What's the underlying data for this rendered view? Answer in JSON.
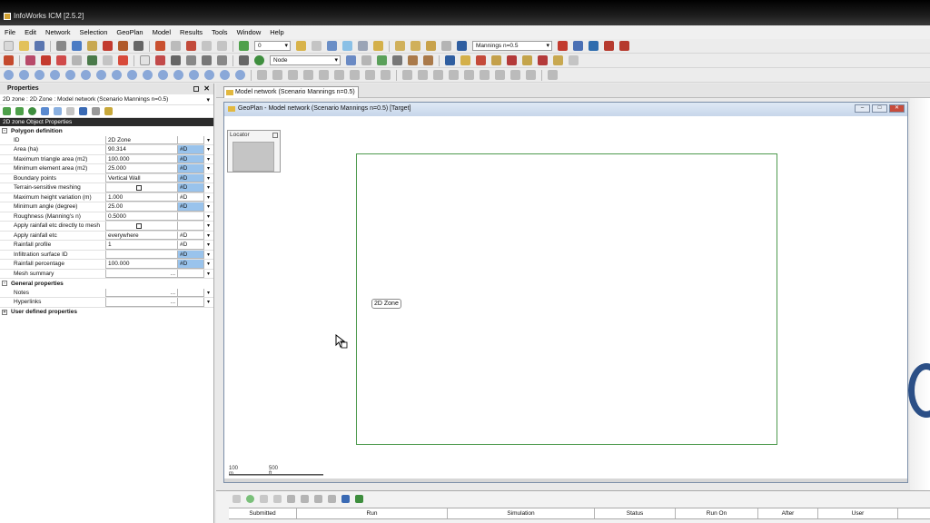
{
  "window": {
    "title": "InfoWorks ICM [2.5.2]"
  },
  "menu": [
    "File",
    "Edit",
    "Network",
    "Selection",
    "GeoPlan",
    "Model",
    "Results",
    "Tools",
    "Window",
    "Help"
  ],
  "toolbar1": {
    "counter_value": "0",
    "scenario_combo": "Mannings n=0.5"
  },
  "toolbar2": {
    "object_type_combo": "Node"
  },
  "properties": {
    "title": "Properties",
    "subtitle": "2D zone : 2D Zone : Model network (Scenario Mannings n=0.5)",
    "object_header": "2D zone Object Properties",
    "sections": [
      {
        "label": "Polygon definition",
        "toggle": "-"
      },
      {
        "label": "General properties",
        "toggle": "-"
      },
      {
        "label": "User defined properties",
        "toggle": "+"
      }
    ],
    "polygon_rows": [
      {
        "name": "ID",
        "value": "2D Zone",
        "flag": "",
        "flag_blue": false,
        "checkbox": false,
        "ellipsis": false
      },
      {
        "name": "Area (ha)",
        "value": "90.314",
        "flag": "#D",
        "flag_blue": true,
        "checkbox": false,
        "ellipsis": false
      },
      {
        "name": "Maximum triangle area (m2)",
        "value": "100.000",
        "flag": "#D",
        "flag_blue": true,
        "checkbox": false,
        "ellipsis": false
      },
      {
        "name": "Minimum element area (m2)",
        "value": "25.000",
        "flag": "#D",
        "flag_blue": true,
        "checkbox": false,
        "ellipsis": false
      },
      {
        "name": "Boundary points",
        "value": "Vertical Wall",
        "flag": "#D",
        "flag_blue": true,
        "checkbox": false,
        "ellipsis": false
      },
      {
        "name": "Terrain-sensitive meshing",
        "value": "",
        "flag": "#D",
        "flag_blue": true,
        "checkbox": true,
        "ellipsis": false
      },
      {
        "name": "Maximum height variation (m)",
        "value": "1.000",
        "flag": "#D",
        "flag_blue": false,
        "checkbox": false,
        "ellipsis": false
      },
      {
        "name": "Minimum angle (degree)",
        "value": "25.00",
        "flag": "#D",
        "flag_blue": true,
        "checkbox": false,
        "ellipsis": false
      },
      {
        "name": "Roughness (Manning's n)",
        "value": "0.5000",
        "flag": "",
        "flag_blue": false,
        "checkbox": false,
        "ellipsis": false
      },
      {
        "name": "Apply rainfall etc directly to mesh",
        "value": "",
        "flag": "",
        "flag_blue": false,
        "checkbox": true,
        "ellipsis": false
      },
      {
        "name": "Apply rainfall etc",
        "value": "everywhere",
        "flag": "#D",
        "flag_blue": false,
        "checkbox": false,
        "ellipsis": false
      },
      {
        "name": "Rainfall profile",
        "value": "1",
        "flag": "#D",
        "flag_blue": false,
        "checkbox": false,
        "ellipsis": false
      },
      {
        "name": "Infiltration surface ID",
        "value": "",
        "flag": "#D",
        "flag_blue": true,
        "checkbox": false,
        "ellipsis": false
      },
      {
        "name": "Rainfall percentage",
        "value": "100.000",
        "flag": "#D",
        "flag_blue": true,
        "checkbox": false,
        "ellipsis": false
      },
      {
        "name": "Mesh summary",
        "value": "",
        "flag": "",
        "flag_blue": false,
        "checkbox": false,
        "ellipsis": true
      }
    ],
    "general_rows": [
      {
        "name": "Notes",
        "value": "",
        "flag": "",
        "flag_blue": false,
        "checkbox": false,
        "ellipsis": true
      },
      {
        "name": "Hyperlinks",
        "value": "",
        "flag": "",
        "flag_blue": false,
        "checkbox": false,
        "ellipsis": true
      }
    ]
  },
  "doc_tab": {
    "label": "Model network (Scenario Mannings n=0.5)"
  },
  "geoplan": {
    "title": "GeoPlan - Model network (Scenario Mannings n=0.5)  [Target]",
    "locator_title": "Locator",
    "zone_label": "2D Zone",
    "scale_m": "100 m",
    "scale_ft": "500 ft"
  },
  "jobs_table": {
    "columns": [
      "Submitted",
      "Run",
      "Simulation",
      "Status",
      "Run On",
      "After",
      "User"
    ]
  },
  "colors": {
    "zone_outline": "#4e9a4e",
    "flag_blue": "#99c3ec",
    "title_gradient": "#c7d6ea"
  }
}
